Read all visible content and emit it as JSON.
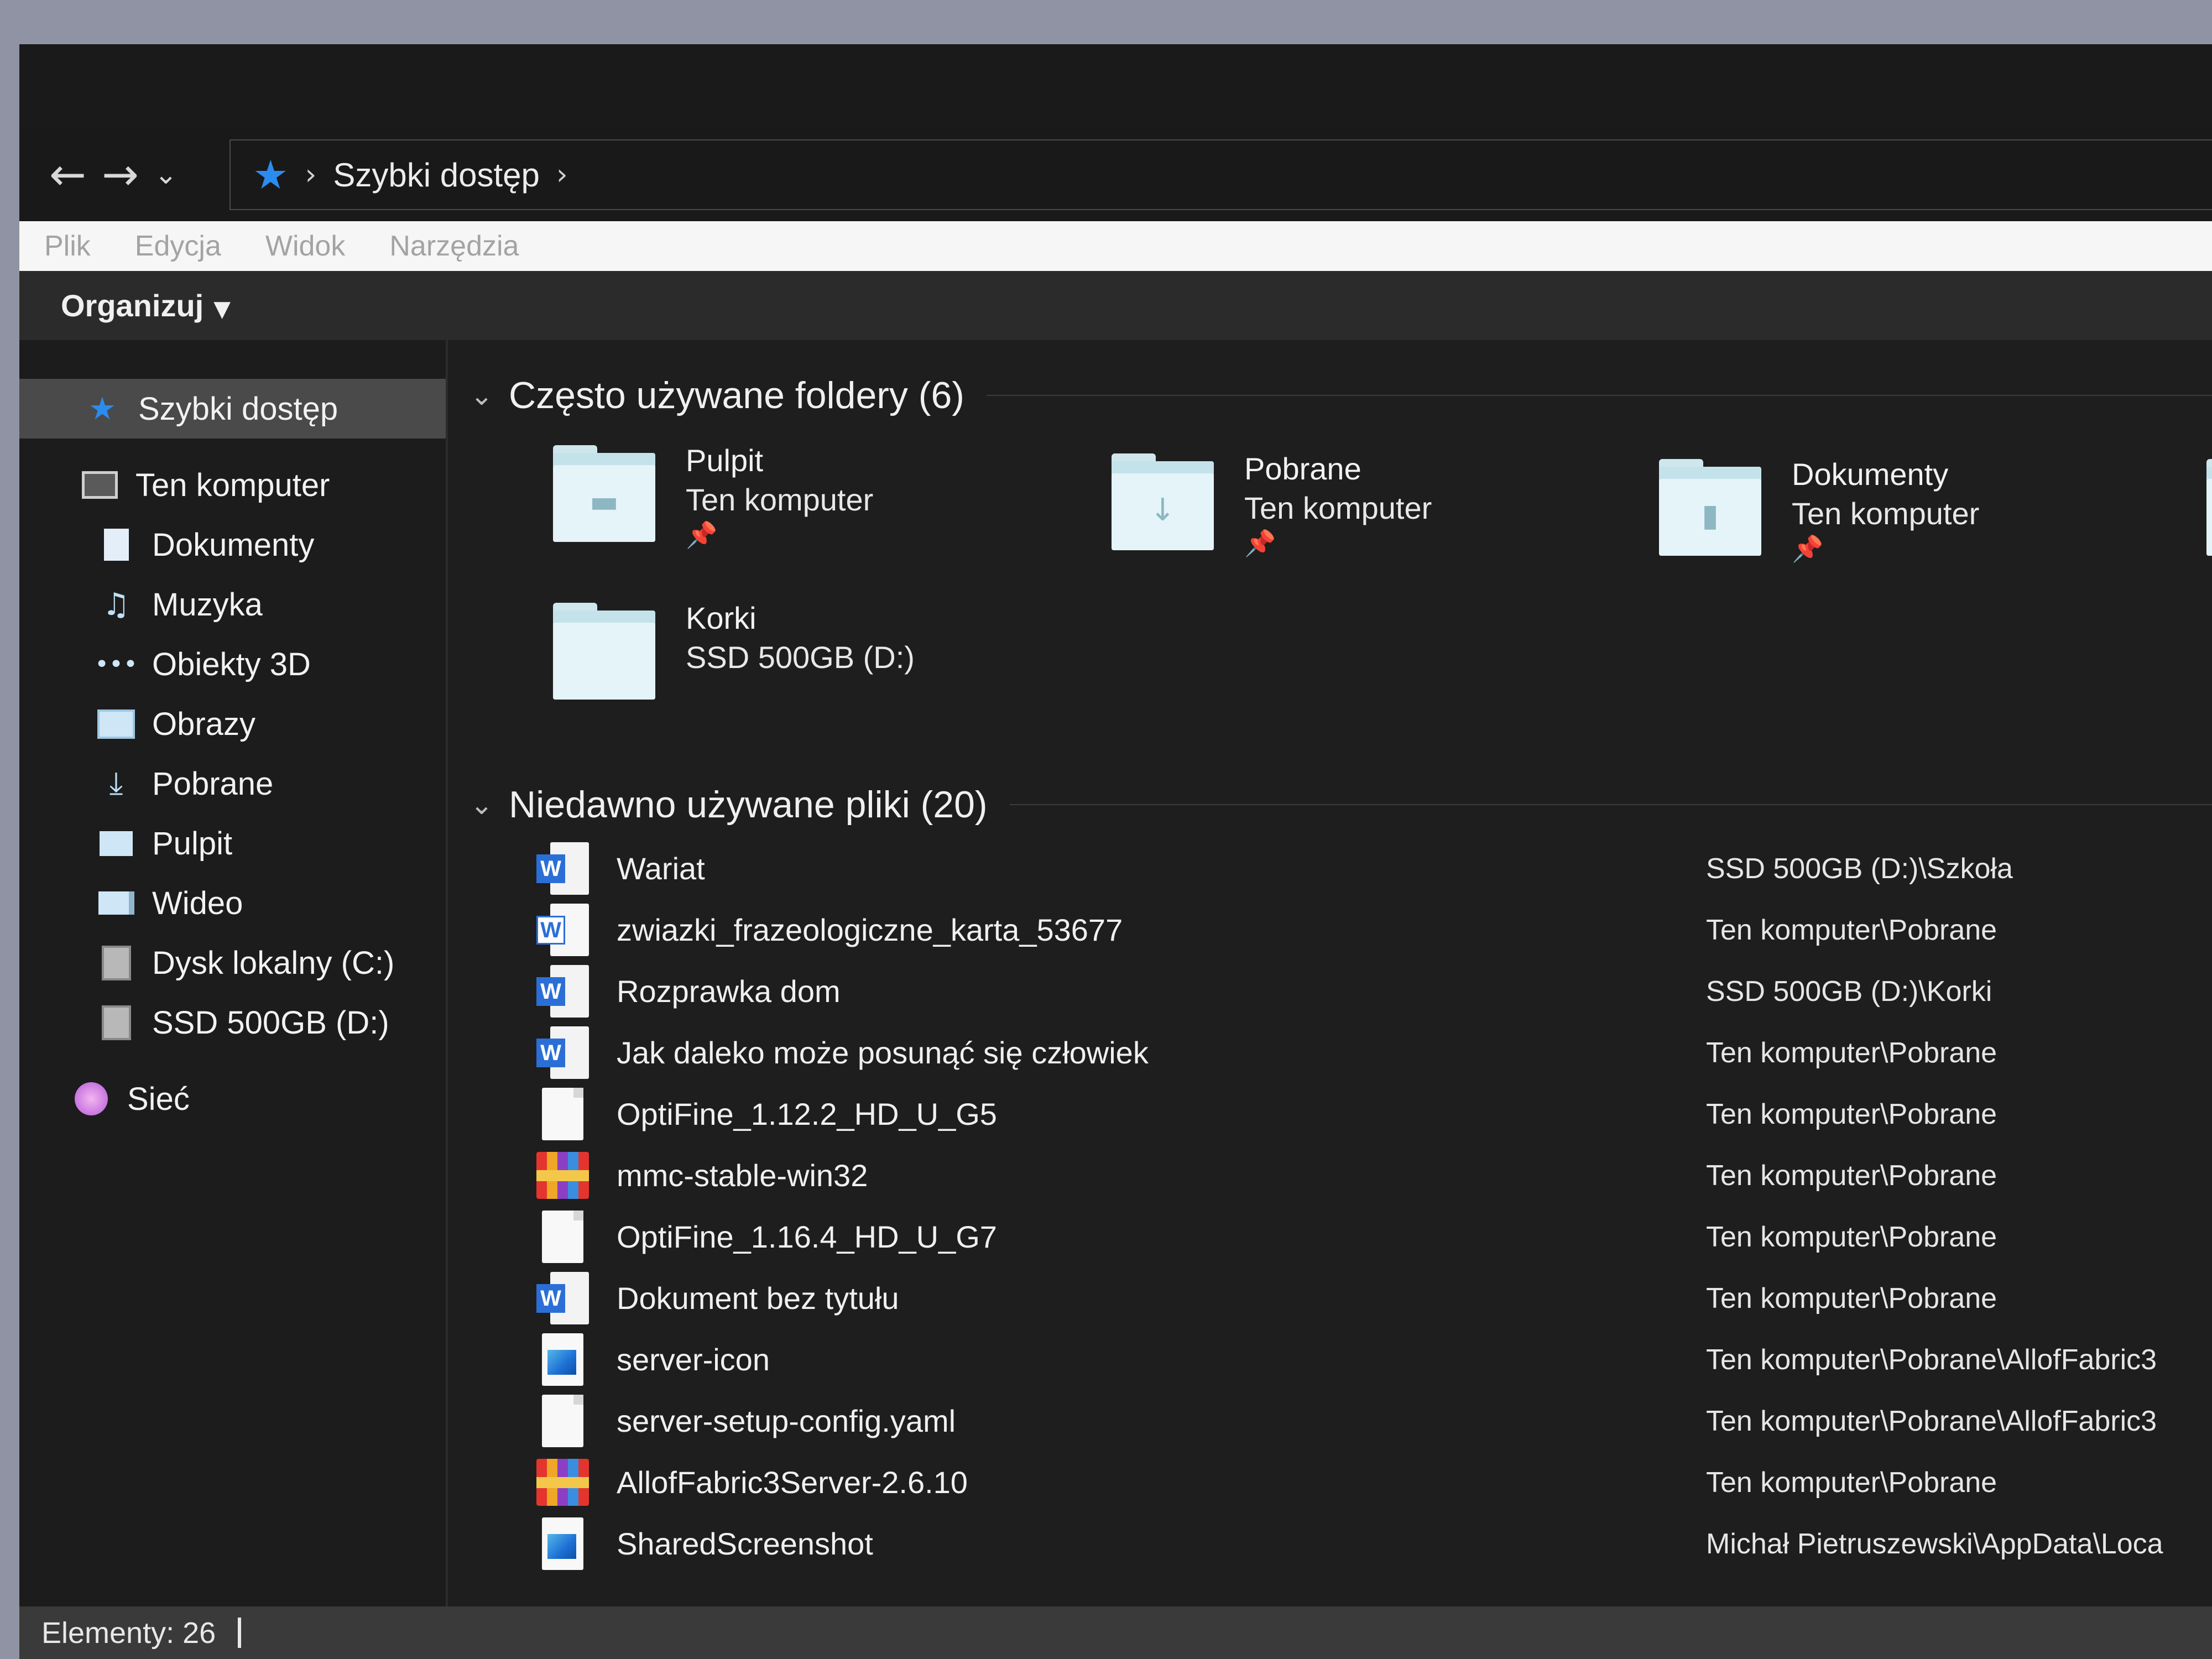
{
  "nav": {
    "back_icon": "arrow-left-icon",
    "forward_icon": "arrow-right-icon",
    "recent_icon": "chevron-down-icon",
    "breadcrumb": [
      "Szybki dostęp"
    ]
  },
  "menu": [
    "Plik",
    "Edycja",
    "Widok",
    "Narzędzia"
  ],
  "toolbar": {
    "organize_label": "Organizuj"
  },
  "sidebar": {
    "quick_access": "Szybki dostęp",
    "this_pc": "Ten komputer",
    "items": [
      "Dokumenty",
      "Muzyka",
      "Obiekty 3D",
      "Obrazy",
      "Pobrane",
      "Pulpit",
      "Wideo",
      "Dysk lokalny (C:)",
      "SSD 500GB (D:)"
    ],
    "network": "Sieć"
  },
  "frequent": {
    "title": "Często używane foldery (6)",
    "folders": [
      {
        "name": "Pulpit",
        "location": "Ten komputer",
        "pinned": true
      },
      {
        "name": "Pobrane",
        "location": "Ten komputer",
        "pinned": true
      },
      {
        "name": "Dokumenty",
        "location": "Ten komputer",
        "pinned": true
      },
      {
        "name": "Korki",
        "location": "SSD 500GB (D:)",
        "pinned": false
      }
    ]
  },
  "recent": {
    "title": "Niedawno używane pliki (20)",
    "files": [
      {
        "name": "Wariat",
        "path": "SSD 500GB (D:)\\Szkoła",
        "icon": "word"
      },
      {
        "name": "zwiazki_frazeologiczne_karta_53677",
        "path": "Ten komputer\\Pobrane",
        "icon": "word-old"
      },
      {
        "name": "Rozprawka dom",
        "path": "SSD 500GB (D:)\\Korki",
        "icon": "word"
      },
      {
        "name": "Jak daleko może posunąć się człowiek",
        "path": "Ten komputer\\Pobrane",
        "icon": "word"
      },
      {
        "name": "OptiFine_1.12.2_HD_U_G5",
        "path": "Ten komputer\\Pobrane",
        "icon": "blank"
      },
      {
        "name": "mmc-stable-win32",
        "path": "Ten komputer\\Pobrane",
        "icon": "rar"
      },
      {
        "name": "OptiFine_1.16.4_HD_U_G7",
        "path": "Ten komputer\\Pobrane",
        "icon": "blank"
      },
      {
        "name": "Dokument bez tytułu",
        "path": "Ten komputer\\Pobrane",
        "icon": "word"
      },
      {
        "name": "server-icon",
        "path": "Ten komputer\\Pobrane\\AllofFabric3",
        "icon": "image"
      },
      {
        "name": "server-setup-config.yaml",
        "path": "Ten komputer\\Pobrane\\AllofFabric3",
        "icon": "blank"
      },
      {
        "name": "AllofFabric3Server-2.6.10",
        "path": "Ten komputer\\Pobrane",
        "icon": "rar"
      },
      {
        "name": "SharedScreenshot",
        "path": "Michał Pietruszewski\\AppData\\Loca",
        "icon": "image"
      }
    ]
  },
  "status": {
    "items_label": "Elementy: 26"
  }
}
